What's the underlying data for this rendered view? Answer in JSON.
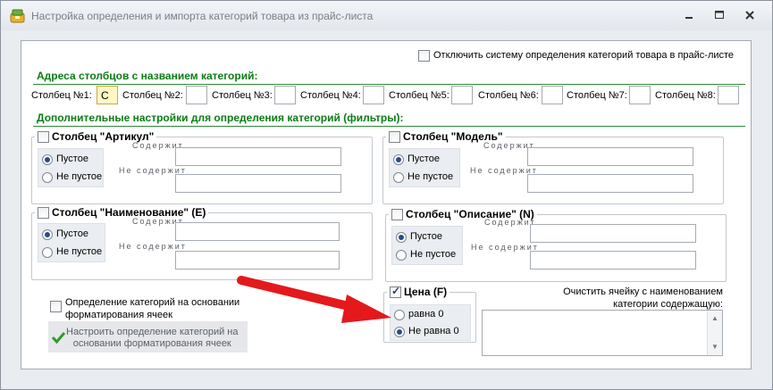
{
  "window": {
    "title": "Настройка определения и импорта категорий товара из прайс-листа",
    "controls": [
      "minimize",
      "maximize",
      "close"
    ]
  },
  "top_option": {
    "label": "Отключить систему определения категорий товара в прайс-листе",
    "checked": false
  },
  "columns_section": {
    "title": "Адреса столбцов с названием категорий:",
    "columns": [
      {
        "label": "Столбец №1:",
        "value": "C"
      },
      {
        "label": "Столбец №2:",
        "value": ""
      },
      {
        "label": "Столбец №3:",
        "value": ""
      },
      {
        "label": "Столбец №4:",
        "value": ""
      },
      {
        "label": "Столбец №5:",
        "value": ""
      },
      {
        "label": "Столбец №6:",
        "value": ""
      },
      {
        "label": "Столбец №7:",
        "value": ""
      },
      {
        "label": "Столбец №8:",
        "value": ""
      }
    ]
  },
  "filters_section": {
    "title": "Дополнительные настройки для определения категорий (фильтры):",
    "groups": [
      {
        "title": "Столбец \"Артикул\"",
        "checked": false,
        "opt1": "Пустое",
        "opt2": "Не пустое",
        "selected": 1,
        "contains": "Содержит",
        "not_contains": "Не содержит"
      },
      {
        "title": "Столбец \"Модель\"",
        "checked": false,
        "opt1": "Пустое",
        "opt2": "Не пустое",
        "selected": 1,
        "contains": "Содержит",
        "not_contains": "Не содержит"
      },
      {
        "title": "Столбец \"Наименование\" (E)",
        "checked": false,
        "opt1": "Пустое",
        "opt2": "Не пустое",
        "selected": 1,
        "contains": "Содержит",
        "not_contains": "Не содержит"
      },
      {
        "title": "Столбец \"Описание\" (N)",
        "checked": false,
        "opt1": "Пустое",
        "opt2": "Не пустое",
        "selected": 1,
        "contains": "Содержит",
        "not_contains": "Не содержит"
      }
    ]
  },
  "format_option": {
    "label_line1": "Определение категорий на основании",
    "label_line2": "форматирования ячеек",
    "checked": false,
    "button_line1": "Настроить определение категорий на",
    "button_line2": "основании форматирования ячеек"
  },
  "price_group": {
    "title": "Цена (F)",
    "checked": true,
    "opt1": "равна 0",
    "opt2": "Не равна 0",
    "selected": 2
  },
  "clear_cell": {
    "label_line1": "Очистить ячейку с наименованием",
    "label_line2": "категории содержащую:",
    "value": ""
  },
  "colors": {
    "section_title": "#0b7d16",
    "arrow": "#e3191c"
  }
}
